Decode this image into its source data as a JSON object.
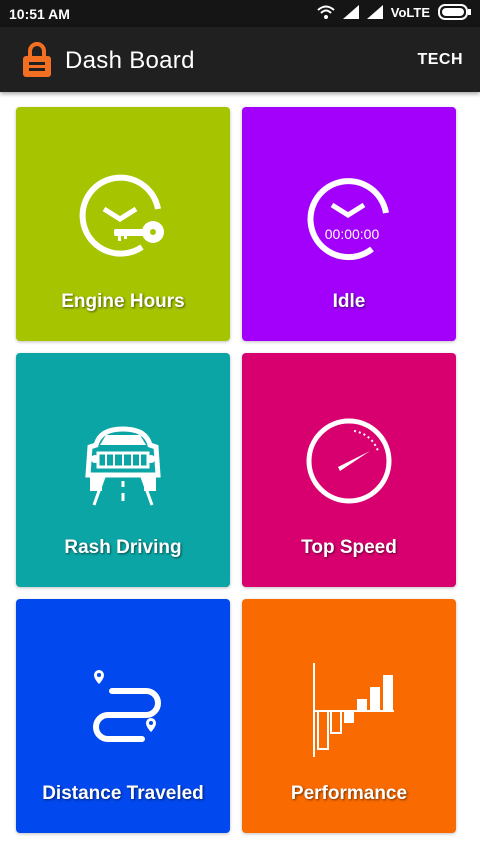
{
  "status_bar": {
    "time": "10:51 AM",
    "network": "VoLTE",
    "icons": [
      "wifi-icon",
      "signal-icon",
      "signal-icon",
      "battery-icon"
    ]
  },
  "app_bar": {
    "title": "Dash Board",
    "action_label": "TECH",
    "logo": "lock-logo",
    "logo_color": "#f36f21"
  },
  "tiles": [
    {
      "label": "Engine Hours",
      "icon": "clock-key-icon",
      "color": "#a6c400"
    },
    {
      "label": "Idle",
      "icon": "timer-icon",
      "color": "#a200fb",
      "timer_text": "00:00:00"
    },
    {
      "label": "Rash Driving",
      "icon": "car-icon",
      "color": "#0ba5a5"
    },
    {
      "label": "Top Speed",
      "icon": "speedometer-icon",
      "color": "#d8006e"
    },
    {
      "label": "Distance Traveled",
      "icon": "route-icon",
      "color": "#0148ee"
    },
    {
      "label": "Performance",
      "icon": "bar-chart-icon",
      "color": "#f96a00"
    }
  ]
}
